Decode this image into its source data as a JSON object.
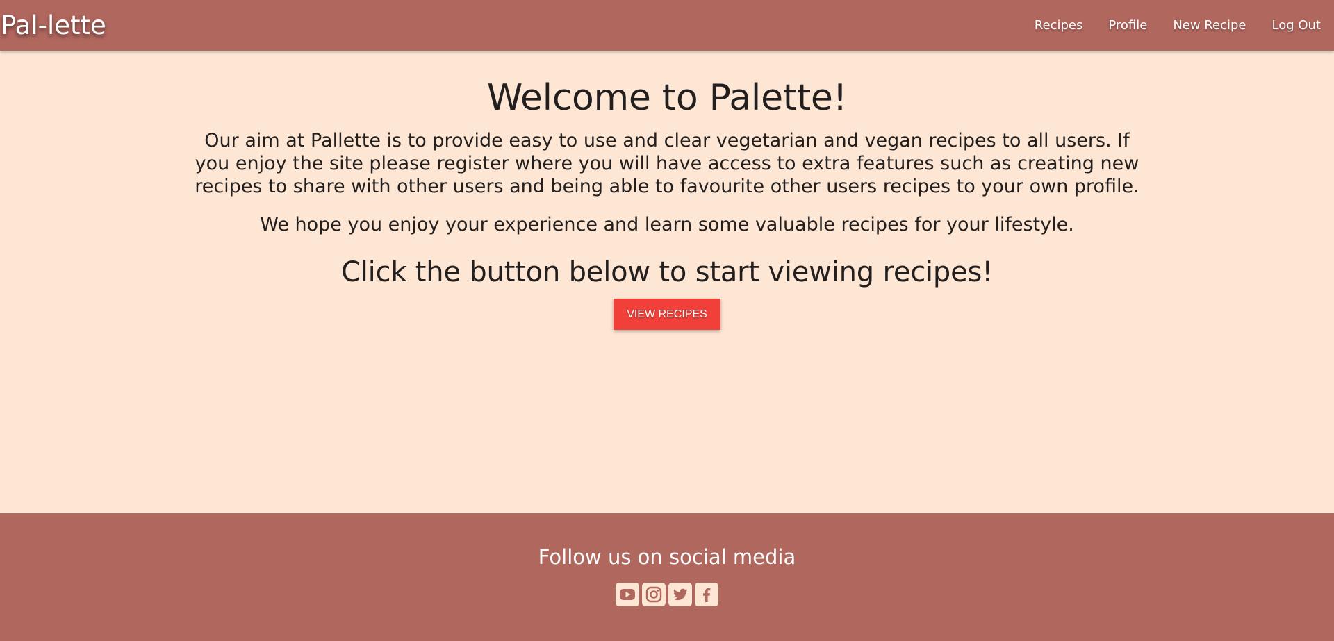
{
  "navbar": {
    "brand": "Pal-lette",
    "links": [
      {
        "label": "Recipes"
      },
      {
        "label": "Profile"
      },
      {
        "label": "New Recipe"
      },
      {
        "label": "Log Out"
      }
    ]
  },
  "main": {
    "welcome_title": "Welcome to Palette!",
    "intro_text": "Our aim at Pallette is to provide easy to use and clear vegetarian and vegan recipes to all users. If you enjoy the site please register where you will have access to extra features such as creating new recipes to share with other users and being able to favourite other users recipes to your own profile.",
    "hope_text": "We hope you enjoy your experience and learn some valuable recipes for your lifestyle.",
    "cta_title": "Click the button below to start viewing recipes!",
    "view_button_label": "VIEW RECIPES"
  },
  "footer": {
    "title": "Follow us on social media",
    "socials": [
      "youtube-icon",
      "instagram-icon",
      "twitter-icon",
      "facebook-icon"
    ]
  },
  "colors": {
    "nav_bg": "#b0675e",
    "page_bg": "#fde6d3",
    "button_bg": "#f1403a",
    "text": "#231f1f"
  }
}
